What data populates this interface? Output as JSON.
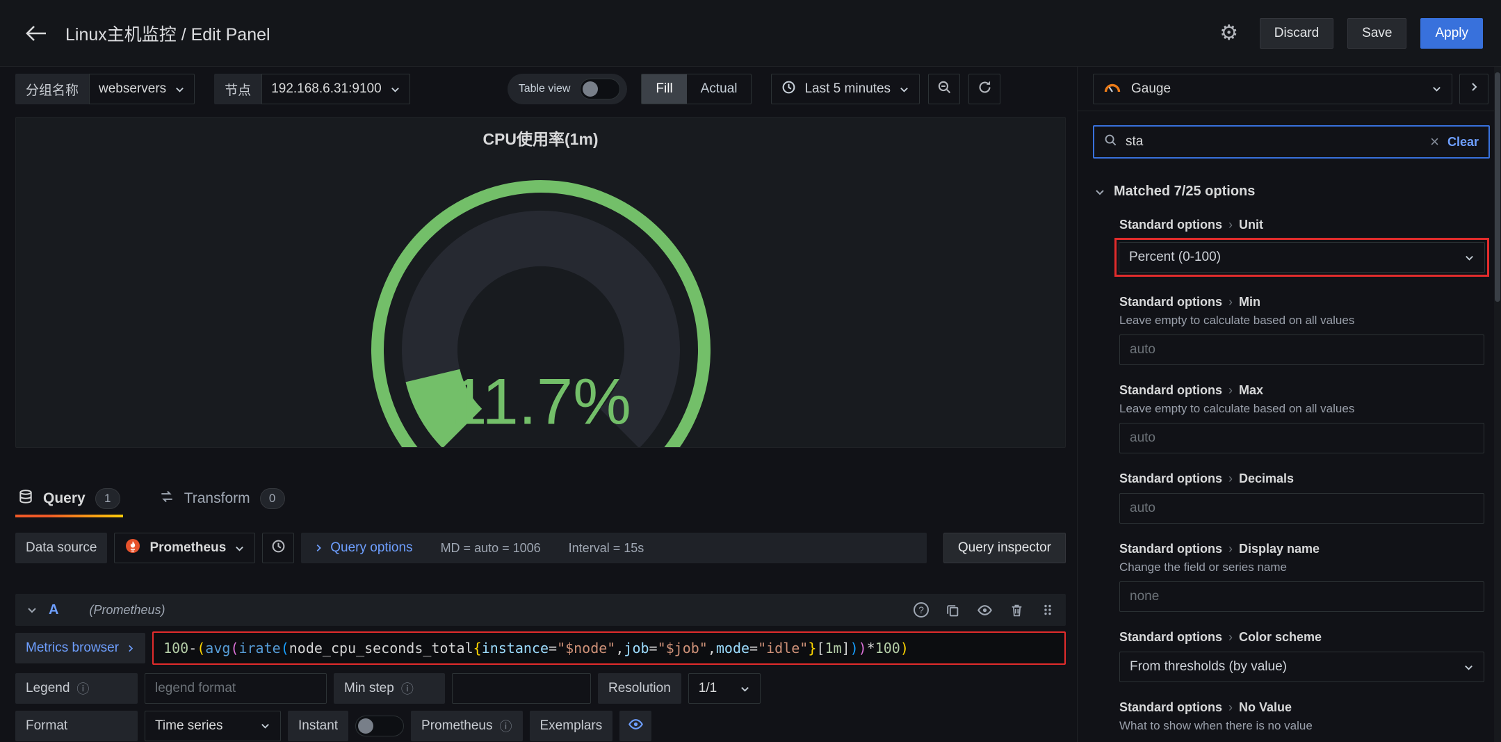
{
  "header": {
    "title": "Linux主机监控 / Edit Panel",
    "discard_label": "Discard",
    "save_label": "Save",
    "apply_label": "Apply"
  },
  "toolbar": {
    "group_label": "分组名称",
    "group_value": "webservers",
    "node_label": "节点",
    "node_value": "192.168.6.31:9100",
    "table_view_label": "Table view",
    "fill_label": "Fill",
    "actual_label": "Actual",
    "time_range_label": "Last 5 minutes"
  },
  "viz_picker": {
    "value": "Gauge"
  },
  "panel": {
    "title": "CPU使用率(1m)"
  },
  "chart_data": {
    "type": "gauge",
    "title": "CPU使用率(1m)",
    "value": 11.7,
    "value_text": "11.7%",
    "unit": "percent (0-100)",
    "min": 0,
    "max": 100,
    "arc_degrees": 270,
    "value_color": "#73bf69"
  },
  "tabs": {
    "query_label": "Query",
    "query_count": "1",
    "transform_label": "Transform",
    "transform_count": "0"
  },
  "query": {
    "datasource_label": "Data source",
    "datasource_value": "Prometheus",
    "query_options_label": "Query options",
    "md_text": "MD = auto = 1006",
    "interval_text": "Interval = 15s",
    "inspector_label": "Query inspector",
    "ref_id": "A",
    "ref_note": "(Prometheus)",
    "metrics_browser_label": "Metrics browser",
    "expression_text": "100 - (avg(irate(node_cpu_seconds_total{instance=\"$node\",job=\"$job\",mode=\"idle\"}[1m]))*100)",
    "expression_tokens": [
      {
        "t": "100 ",
        "c": "num"
      },
      {
        "t": "- ",
        "c": "op"
      },
      {
        "t": "(",
        "c": "paren1"
      },
      {
        "t": "avg",
        "c": "fn"
      },
      {
        "t": "(",
        "c": "paren2"
      },
      {
        "t": "irate",
        "c": "fn"
      },
      {
        "t": "(",
        "c": "paren3"
      },
      {
        "t": "node_cpu_seconds_total",
        "c": "metric"
      },
      {
        "t": "{",
        "c": "brace"
      },
      {
        "t": "instance",
        "c": "label"
      },
      {
        "t": "=",
        "c": "op"
      },
      {
        "t": "\"$node\"",
        "c": "str"
      },
      {
        "t": ",",
        "c": "op"
      },
      {
        "t": "job",
        "c": "label"
      },
      {
        "t": "=",
        "c": "op"
      },
      {
        "t": "\"$job\"",
        "c": "str"
      },
      {
        "t": ",",
        "c": "op"
      },
      {
        "t": "mode",
        "c": "label"
      },
      {
        "t": "=",
        "c": "op"
      },
      {
        "t": "\"idle\"",
        "c": "str"
      },
      {
        "t": "}",
        "c": "brace"
      },
      {
        "t": "[",
        "c": "bracket"
      },
      {
        "t": "1m",
        "c": "num"
      },
      {
        "t": "]",
        "c": "bracket"
      },
      {
        "t": ")",
        "c": "paren3"
      },
      {
        "t": ")",
        "c": "paren2"
      },
      {
        "t": "*",
        "c": "op"
      },
      {
        "t": "100",
        "c": "num"
      },
      {
        "t": ")",
        "c": "paren1"
      }
    ],
    "legend_label": "Legend",
    "legend_placeholder": "legend format",
    "min_step_label": "Min step",
    "resolution_label": "Resolution",
    "resolution_value": "1/1",
    "format_label": "Format",
    "format_value": "Time series",
    "instant_label": "Instant",
    "prometheus_label": "Prometheus",
    "exemplars_label": "Exemplars"
  },
  "sidebar": {
    "search_value": "sta",
    "clear_label": "Clear",
    "matched_label": "Matched 7/25 options",
    "options": [
      {
        "category": "Standard options",
        "name": "Unit",
        "control": "select",
        "value": "Percent (0-100)",
        "highlight": true
      },
      {
        "category": "Standard options",
        "name": "Min",
        "desc": "Leave empty to calculate based on all values",
        "control": "input",
        "placeholder": "auto"
      },
      {
        "category": "Standard options",
        "name": "Max",
        "desc": "Leave empty to calculate based on all values",
        "control": "input",
        "placeholder": "auto"
      },
      {
        "category": "Standard options",
        "name": "Decimals",
        "control": "input",
        "placeholder": "auto"
      },
      {
        "category": "Standard options",
        "name": "Display name",
        "desc": "Change the field or series name",
        "control": "input",
        "placeholder": "none"
      },
      {
        "category": "Standard options",
        "name": "Color scheme",
        "control": "select",
        "value": "From thresholds (by value)"
      },
      {
        "category": "Standard options",
        "name": "No Value",
        "desc": "What to show when there is no value",
        "control": "none"
      }
    ]
  },
  "colors": {
    "accent_blue": "#3871dc",
    "link_blue": "#6e9fff",
    "gauge_green": "#73bf69",
    "tab_underline_orange": "#f05a28",
    "highlight_red": "#e22c2c",
    "prometheus_orange": "#e6522c"
  }
}
